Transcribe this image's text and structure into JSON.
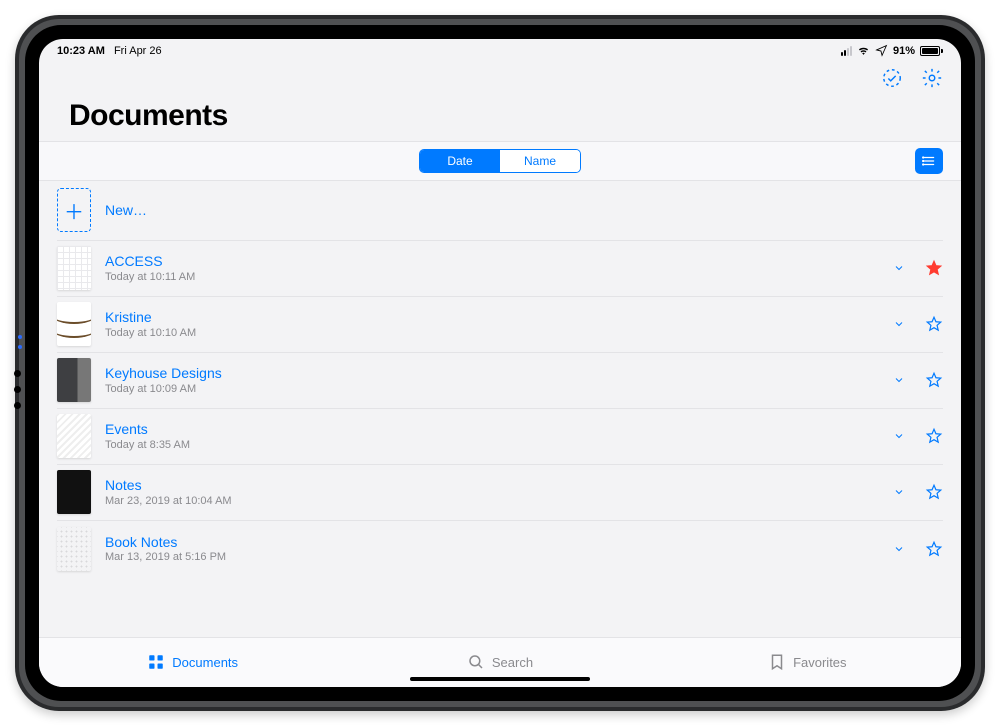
{
  "status": {
    "time": "10:23 AM",
    "date": "Fri Apr 26",
    "battery": "91%"
  },
  "toolbar": {
    "select_hint": "",
    "title": "Documents"
  },
  "segment": {
    "date": "Date",
    "name": "Name"
  },
  "new_label": "New…",
  "items": [
    {
      "title": "ACCESS",
      "subtitle": "Today at 10:11 AM",
      "thumb": "grid",
      "fav": true
    },
    {
      "title": "Kristine",
      "subtitle": "Today at 10:10 AM",
      "thumb": "wave",
      "fav": false
    },
    {
      "title": "Keyhouse Designs",
      "subtitle": "Today at 10:09 AM",
      "thumb": "dark",
      "fav": false
    },
    {
      "title": "Events",
      "subtitle": "Today at 8:35 AM",
      "thumb": "lines",
      "fav": false
    },
    {
      "title": "Notes",
      "subtitle": "Mar 23, 2019 at 10:04 AM",
      "thumb": "black",
      "fav": false
    },
    {
      "title": "Book Notes",
      "subtitle": "Mar 13, 2019 at 5:16 PM",
      "thumb": "dots",
      "fav": false
    }
  ],
  "tabs": {
    "documents": "Documents",
    "search": "Search",
    "favorites": "Favorites"
  }
}
